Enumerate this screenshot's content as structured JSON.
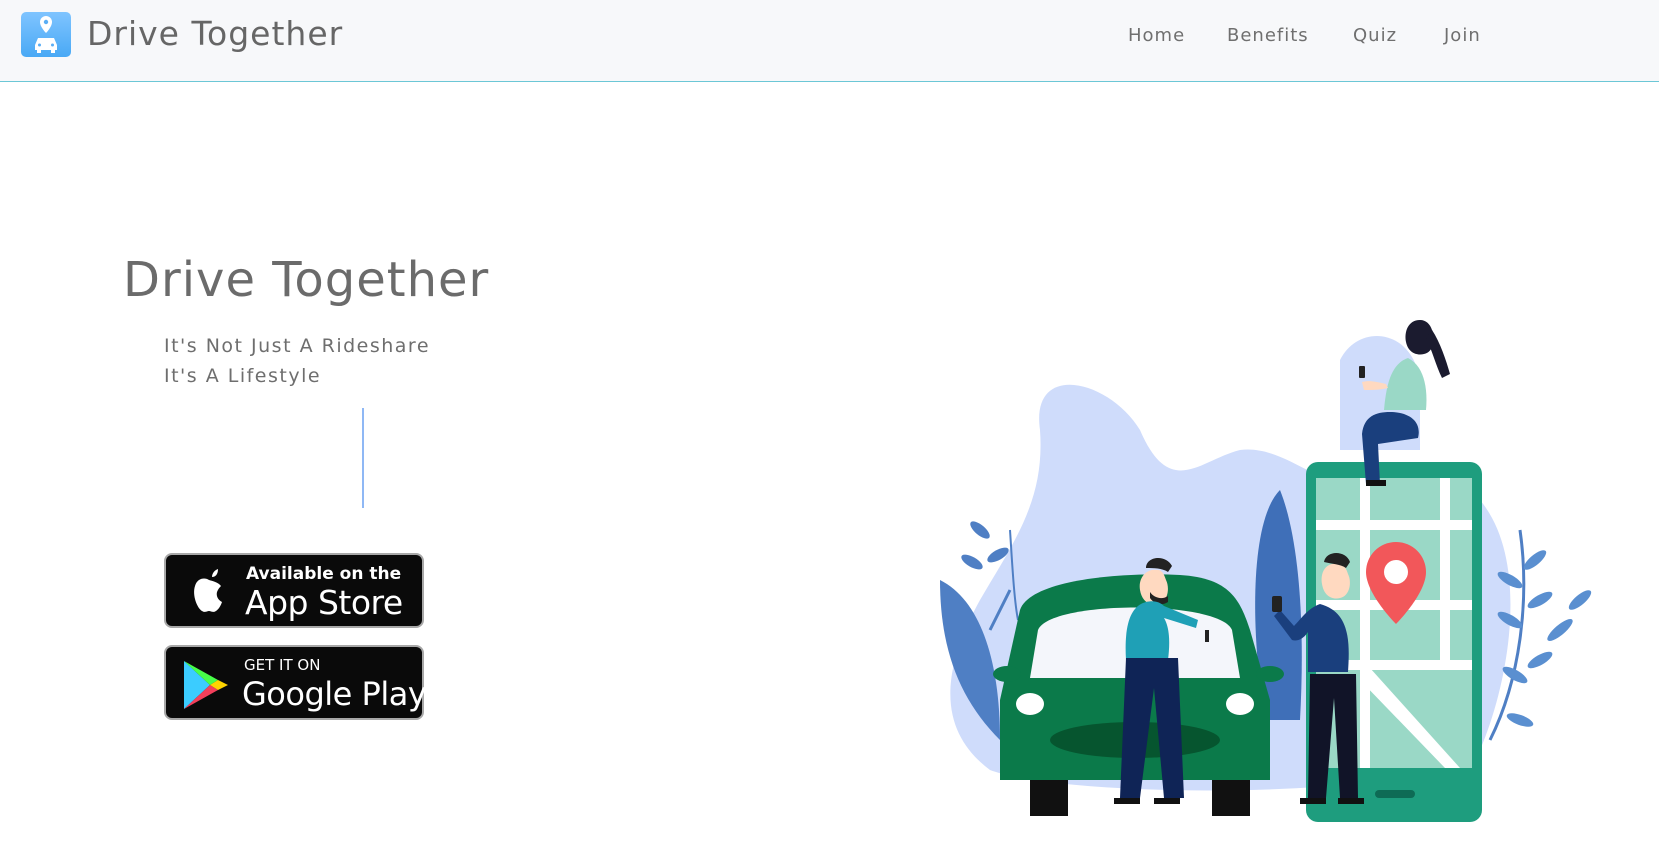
{
  "navbar": {
    "brand": "Drive Together",
    "links": [
      "Home",
      "Benefits",
      "Quiz",
      "Join"
    ]
  },
  "hero": {
    "title": "Drive Together",
    "tagline_1": "It's Not Just A Rideshare",
    "tagline_2": "It's A Lifestyle"
  },
  "badges": {
    "appstore": {
      "small": "Available on the",
      "big": "App Store"
    },
    "googleplay": {
      "small": "GET IT ON",
      "big": "Google Play"
    }
  },
  "colors": {
    "navbar_bg": "#f7f8fa",
    "navbar_border": "#6cc7d6",
    "text_gray": "#6b6b6b",
    "car_green": "#0b7a4a",
    "phone_teal": "#1e9d7e",
    "pin_red": "#f2575a"
  }
}
